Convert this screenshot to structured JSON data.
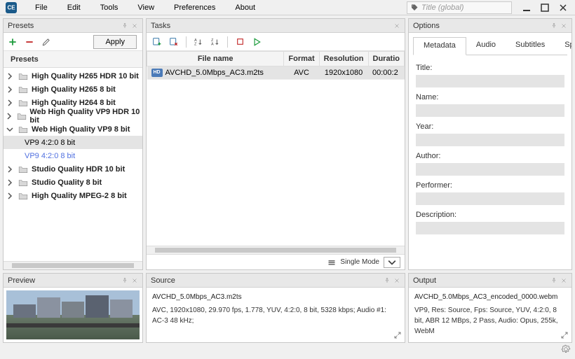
{
  "menu": {
    "items": [
      "File",
      "Edit",
      "Tools",
      "View",
      "Preferences",
      "About"
    ]
  },
  "title_search": {
    "placeholder": "Title  (global)"
  },
  "panels": {
    "presets": "Presets",
    "tasks": "Tasks",
    "options": "Options",
    "preview": "Preview",
    "source": "Source",
    "output": "Output"
  },
  "presets": {
    "header": "Presets",
    "apply": "Apply",
    "items": [
      {
        "label": "High Quality H265 HDR 10 bit",
        "expanded": false
      },
      {
        "label": "High Quality H265 8 bit",
        "expanded": false
      },
      {
        "label": "High Quality H264 8 bit",
        "expanded": false
      },
      {
        "label": "Web High Quality VP9 HDR 10 bit",
        "expanded": false
      },
      {
        "label": "Web High Quality VP9 8 bit",
        "expanded": true,
        "children": [
          {
            "label": "VP9 4:2:0 8 bit",
            "selected": true
          },
          {
            "label": "VP9 4:2:0 8 bit",
            "highlight": true
          }
        ]
      },
      {
        "label": "Studio Quality HDR 10 bit",
        "expanded": false
      },
      {
        "label": "Studio Quality 8 bit",
        "expanded": false
      },
      {
        "label": "High Quality MPEG-2 8 bit",
        "expanded": false
      }
    ]
  },
  "tasks": {
    "columns": [
      "File name",
      "Format",
      "Resolution",
      "Duratio"
    ],
    "rows": [
      {
        "badge": "HD",
        "filename": "AVCHD_5.0Mbps_AC3.m2ts",
        "format": "AVC",
        "resolution": "1920x1080",
        "duration": "00:00:2"
      }
    ],
    "mode": "Single Mode"
  },
  "options": {
    "tabs": [
      "Metadata",
      "Audio",
      "Subtitles",
      "Split"
    ],
    "active_tab": 0,
    "fields": [
      {
        "label": "Title:",
        "value": ""
      },
      {
        "label": "Name:",
        "value": ""
      },
      {
        "label": "Year:",
        "value": ""
      },
      {
        "label": "Author:",
        "value": ""
      },
      {
        "label": "Performer:",
        "value": ""
      },
      {
        "label": "Description:",
        "value": ""
      }
    ]
  },
  "source": {
    "filename": "AVCHD_5.0Mbps_AC3.m2ts",
    "detail": "AVC, 1920x1080, 29.970 fps, 1.778, YUV, 4:2:0, 8 bit, 5328 kbps; Audio #1: AC-3  48 kHz;"
  },
  "output": {
    "filename": "AVCHD_5.0Mbps_AC3_encoded_0000.webm",
    "detail": "VP9, Res: Source, Fps: Source, YUV, 4:2:0, 8  bit, ABR 12 MBps, 2 Pass, Audio: Opus, 255k, WebM"
  }
}
